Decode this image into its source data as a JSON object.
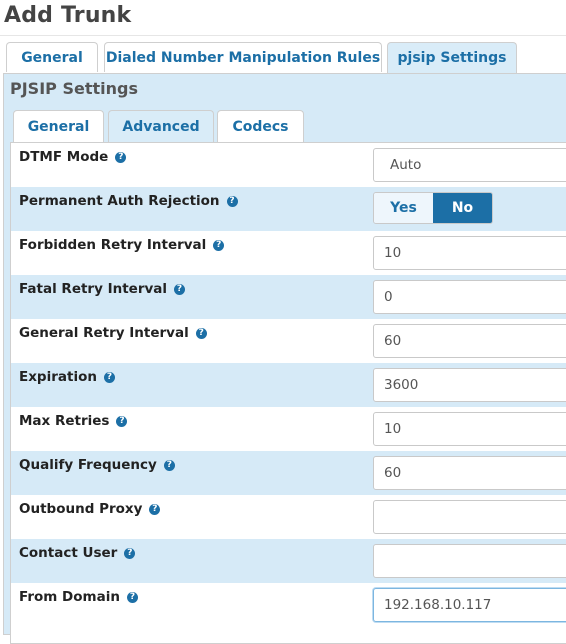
{
  "page_title": "Add Trunk",
  "outer_tabs": [
    {
      "label": "General"
    },
    {
      "label": "Dialed Number Manipulation Rules"
    },
    {
      "label": "pjsip Settings"
    }
  ],
  "panel_title": "PJSIP Settings",
  "inner_tabs": [
    {
      "label": "General"
    },
    {
      "label": "Advanced"
    },
    {
      "label": "Codecs"
    }
  ],
  "settings": {
    "dtmf_mode": {
      "label": "DTMF Mode",
      "value": "Auto"
    },
    "permanent_auth_rejection": {
      "label": "Permanent Auth Rejection",
      "yes_label": "Yes",
      "no_label": "No",
      "selected": "No"
    },
    "forbidden_retry_interval": {
      "label": "Forbidden Retry Interval",
      "value": "10"
    },
    "fatal_retry_interval": {
      "label": "Fatal Retry Interval",
      "value": "0"
    },
    "general_retry_interval": {
      "label": "General Retry Interval",
      "value": "60"
    },
    "expiration": {
      "label": "Expiration",
      "value": "3600"
    },
    "max_retries": {
      "label": "Max Retries",
      "value": "10"
    },
    "qualify_frequency": {
      "label": "Qualify Frequency",
      "value": "60"
    },
    "outbound_proxy": {
      "label": "Outbound Proxy",
      "value": ""
    },
    "contact_user": {
      "label": "Contact User",
      "value": ""
    },
    "from_domain": {
      "label": "From Domain",
      "value": "192.168.10.117"
    }
  },
  "help_glyph": "?",
  "colors": {
    "accent": "#1c6fa6",
    "stripe": "#d6eaf7"
  }
}
